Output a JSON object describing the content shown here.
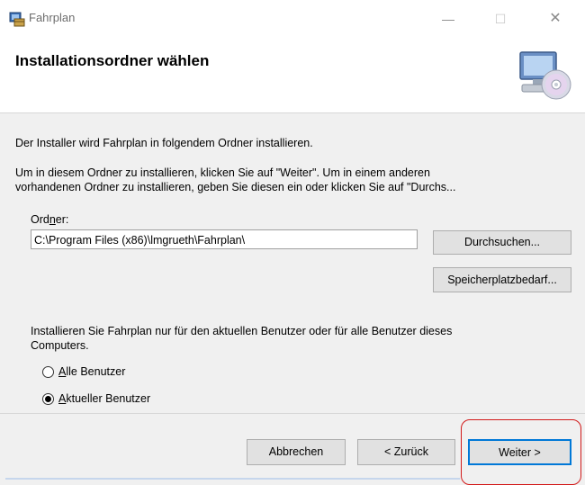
{
  "window": {
    "title": "Fahrplan",
    "controls": {
      "minimize": "—",
      "maximize": "☐",
      "close": "✕"
    }
  },
  "header": {
    "title": "Installationsordner wählen",
    "graphic_icon": "computer-cd-icon"
  },
  "content": {
    "intro": "Der Installer wird Fahrplan in folgendem Ordner installieren.",
    "instructions_line1": "Um in diesem Ordner zu installieren, klicken Sie auf \"Weiter\". Um in einem anderen",
    "instructions_line2": "vorhandenen Ordner zu installieren, geben Sie diesen ein oder klicken Sie auf \"Durchs...",
    "folder_label_pre": "Ord",
    "folder_label_accel": "n",
    "folder_label_post": "er:",
    "folder_value": "C:\\Program Files (x86)\\lmgrueth\\Fahrplan\\",
    "browse_button": "Durchsuchen...",
    "diskspace_button": "Speicherplatzbedarf...",
    "scope_line1": "Installieren Sie Fahrplan nur für den aktuellen Benutzer oder für alle Benutzer dieses",
    "scope_line2": "Computers.",
    "radio_all_accel": "A",
    "radio_all_rest": "lle Benutzer",
    "radio_current_accel": "A",
    "radio_current_rest": "ktueller Benutzer",
    "selected_option": "current"
  },
  "footer": {
    "cancel_button": "Abbrechen",
    "back_button": "< Zurück",
    "next_button": "Weiter >"
  },
  "colors": {
    "highlight": "#d21a1a",
    "body_bg": "#f0f0f0",
    "focus_border": "#0078d7"
  }
}
